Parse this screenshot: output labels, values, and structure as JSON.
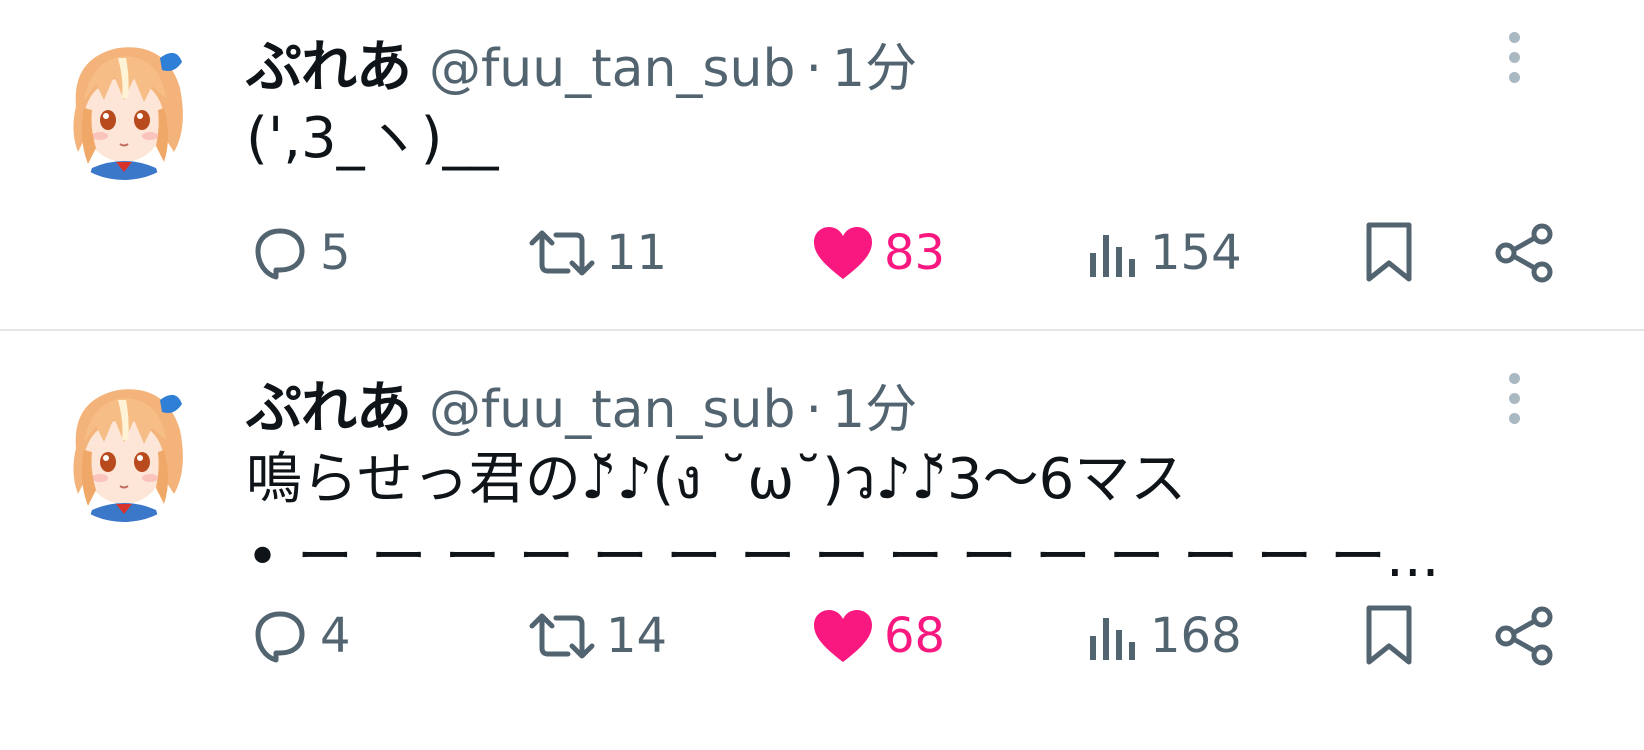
{
  "tweets": [
    {
      "display_name": "ぷれあ",
      "handle": "@fuu_tan_sub",
      "separator": "·",
      "time": "1分",
      "text_lines": [
        "(',3_ヽ)__"
      ],
      "replies": "5",
      "retweets": "11",
      "likes": "83",
      "views": "154"
    },
    {
      "display_name": "ぷれあ",
      "handle": "@fuu_tan_sub",
      "separator": "·",
      "time": "1分",
      "text_lines": [
        "鳴らせっ君の♪̆♪(ง ˘ω˘)ว♪♪̆3〜6マス",
        " • ー ー ー  ー ー  ー  ー ー ー ー ー ー ー ー ー..."
      ],
      "replies": "4",
      "retweets": "14",
      "likes": "68",
      "views": "168"
    }
  ],
  "colors": {
    "text": "#0f1419",
    "secondary": "#536471",
    "like": "#f91880",
    "divider": "#e4e7ea",
    "more_dots": "#aab8c2"
  },
  "icons": [
    "avatar",
    "more-vertical-icon",
    "reply-icon",
    "retweet-icon",
    "heart-icon",
    "views-icon",
    "bookmark-icon",
    "share-icon"
  ]
}
